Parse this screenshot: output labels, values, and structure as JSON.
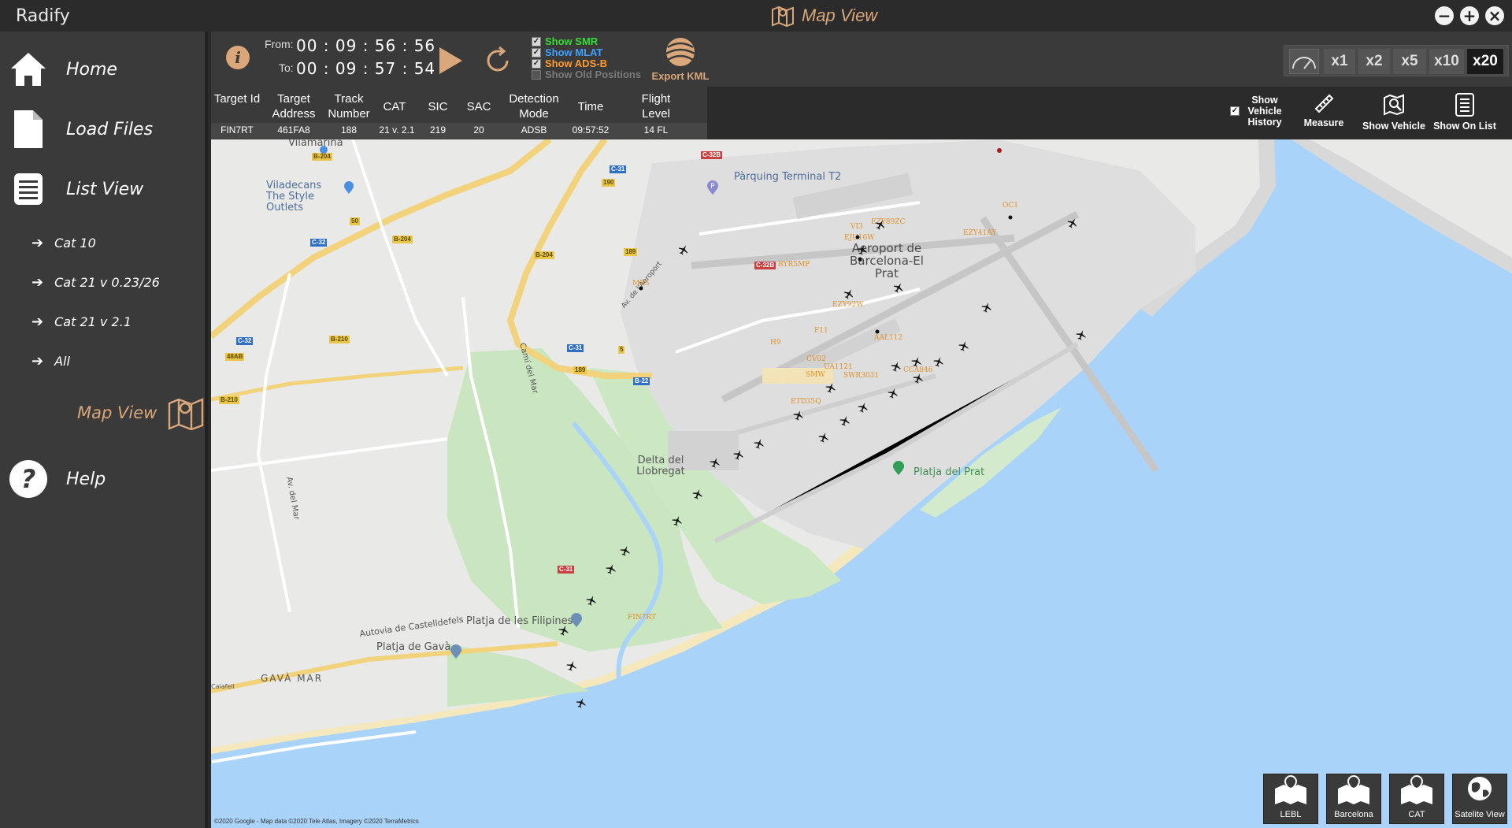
{
  "app": {
    "title": "Radify",
    "window_title": "Map View"
  },
  "window_controls": {
    "minimize": "−",
    "maximize": "+",
    "close": "×"
  },
  "sidebar": {
    "home": "Home",
    "load_files": "Load Files",
    "list_view": "List View",
    "sub_items": [
      "Cat 10",
      "Cat 21 v 0.23/26",
      "Cat 21 v 2.1",
      "All"
    ],
    "map_view": "Map View",
    "help": "Help"
  },
  "toolbar": {
    "from_label": "From:",
    "from_time": "00 : 09 : 56 : 56",
    "to_label": "To:",
    "to_time": "00 : 09 : 57 : 54",
    "show_smr": "Show SMR",
    "show_mlat": "Show MLAT",
    "show_adsb": "Show ADS-B",
    "show_old_positions": "Show Old Positions",
    "export_kml": "Export KML",
    "speeds": [
      "x1",
      "x2",
      "x5",
      "x10",
      "x20"
    ],
    "speed_selected": "x20",
    "colors": {
      "smr": "#33dd33",
      "mlat": "#3fa0ff",
      "adsb": "#ff9a2e",
      "accent": "#d9a77a"
    }
  },
  "info_table": {
    "headers": [
      "Target Id",
      "Target Address",
      "Track Number",
      "CAT",
      "SIC",
      "SAC",
      "Detection Mode",
      "Time",
      "Flight Level"
    ],
    "row": [
      "FIN7RT",
      "461FA8",
      "188",
      "21 v. 2.1",
      "219",
      "20",
      "ADSB",
      "09:57:52",
      "14 FL"
    ]
  },
  "right_tools": {
    "show_vehicle_history": "Show Vehicle History",
    "measure": "Measure",
    "show_vehicle": "Show Vehicle",
    "show_on_list": "Show On List"
  },
  "map": {
    "places": {
      "vilamarina": "Vilamarina",
      "viladecans": "Viladecans The Style Outlets",
      "parking_t2": "Pàrquing Terminal T2",
      "airport": "Aeroport de Barcelona-El Prat",
      "delta": "Delta del Llobregat",
      "platja_prat": "Platja del Prat",
      "platja_filipines": "Platja de les Filipines",
      "platja_gava": "Platja de Gavà",
      "gava_mar": "GAVÀ MAR",
      "autovia": "Autovia de Castelldefels",
      "cami_mar": "Camí del Mar",
      "av_mar": "Av. del Mar",
      "av_aeroport": "Av. de l'Aeroport",
      "calafell": "Calafell"
    },
    "roads": [
      "B-204",
      "C-32B",
      "C-31",
      "190",
      "C-32",
      "50",
      "B-204",
      "B-204",
      "189",
      "C-32B",
      "B-210",
      "C-32",
      "48AB",
      "C-31",
      "5",
      "189",
      "B-22",
      "B-210",
      "C-31"
    ],
    "callsigns": [
      "EZY89ZC",
      "VI3",
      "EJU16W",
      "EZY41AY",
      "OC1",
      "RYR5MP",
      "ME5",
      "EZY92W",
      "F11",
      "H9",
      "AAL112",
      "CV02",
      "UA1121",
      "SMW",
      "SWR3031",
      "CCA846",
      "ETD35Q",
      "FIN7RT"
    ],
    "copyright": "©2020 Google - Map data ©2020 Tele Atlas, Imagery ©2020 TerraMetrics",
    "buttons": [
      "LEBL",
      "Barcelona",
      "CAT",
      "Satelite View"
    ]
  }
}
